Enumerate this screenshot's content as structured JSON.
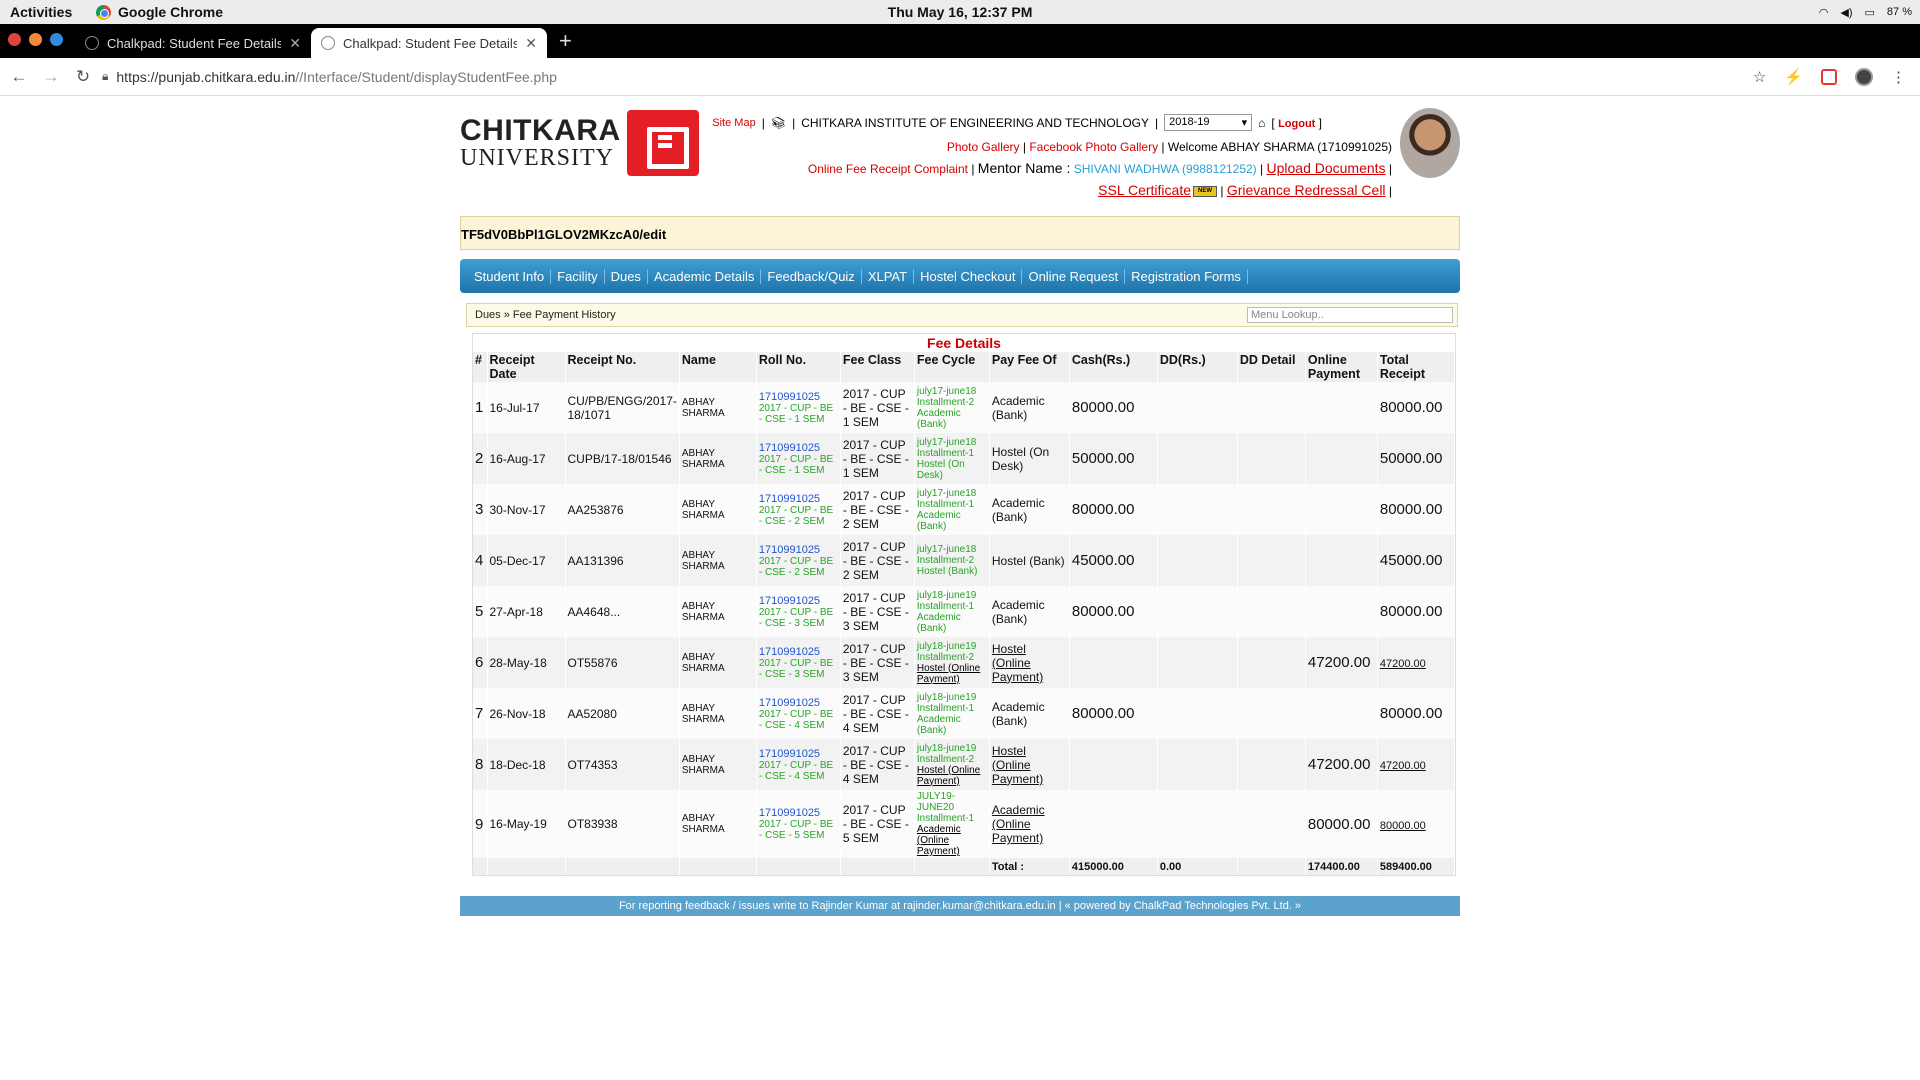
{
  "os": {
    "activities": "Activities",
    "app_name": "Google Chrome",
    "clock": "Thu May 16, 12:37 PM",
    "battery": "87 %"
  },
  "browser": {
    "tabs": [
      {
        "title": "Chalkpad: Student Fee Details"
      },
      {
        "title": "Chalkpad: Student Fee Details"
      }
    ],
    "url_host": "https://punjab.chitkara.edu.in",
    "url_path": "//Interface/Student/displayStudentFee.php"
  },
  "header": {
    "logo_line1": "CHITKARA",
    "logo_line2": "UNIVERSITY",
    "site_map": "Site Map",
    "institute": "CHITKARA INSTITUTE OF ENGINEERING AND TECHNOLOGY",
    "session": "2018-19",
    "logout": "Logout",
    "photo_gallery": "Photo Gallery",
    "facebook_gallery": "Facebook Photo Gallery",
    "welcome": "Welcome ABHAY SHARMA (1710991025)",
    "complaint": "Online Fee Receipt Complaint",
    "mentor_label": "Mentor Name :",
    "mentor_name": "SHIVANI WADHWA (9988121252)",
    "upload_docs": "Upload Documents",
    "ssl": "SSL Certificate",
    "ssl_badge": "NEW",
    "grievance": "Grievance Redressal Cell"
  },
  "notice": "TF5dV0BbPl1GLOV2MKzcA0/edit",
  "menu": [
    "Student Info",
    "Facility",
    "Dues",
    "Academic Details",
    "Feedback/Quiz",
    "XLPAT",
    "Hostel Checkout",
    "Online Request",
    "Registration Forms"
  ],
  "breadcrumb": "Dues » Fee Payment History",
  "menu_lookup_placeholder": "Menu Lookup..",
  "fee": {
    "title": "Fee Details",
    "columns": [
      "#",
      "Receipt Date",
      "Receipt No.",
      "Name",
      "Roll No.",
      "Fee Class",
      "Fee Cycle",
      "Pay Fee Of",
      "Cash(Rs.)",
      "DD(Rs.)",
      "DD Detail",
      "Online Payment",
      "Total Receipt"
    ],
    "rows": [
      {
        "n": "1",
        "date": "16-Jul-17",
        "receipt": "CU/PB/ENGG/2017-18/1071",
        "name": "ABHAY SHARMA",
        "roll": "1710991025",
        "roll_sub": "2017 - CUP - BE - CSE - 1 SEM",
        "fee_class": "2017 - CUP - BE - CSE - 1 SEM",
        "cycle": "july17-june18 Installment-2 Academic (Bank)",
        "pay_of": "Academic (Bank)",
        "cash": "80000.00",
        "dd": "",
        "dd_detail": "",
        "online": "",
        "total": "80000.00"
      },
      {
        "n": "2",
        "date": "16-Aug-17",
        "receipt": "CUPB/17-18/01546",
        "name": "ABHAY SHARMA",
        "roll": "1710991025",
        "roll_sub": "2017 - CUP - BE - CSE - 1 SEM",
        "fee_class": "2017 - CUP - BE - CSE - 1 SEM",
        "cycle": "july17-june18 Installment-1 Hostel (On Desk)",
        "pay_of": "Hostel (On Desk)",
        "cash": "50000.00",
        "dd": "",
        "dd_detail": "",
        "online": "",
        "total": "50000.00"
      },
      {
        "n": "3",
        "date": "30-Nov-17",
        "receipt": "AA253876",
        "name": "ABHAY SHARMA",
        "roll": "1710991025",
        "roll_sub": "2017 - CUP - BE - CSE - 2 SEM",
        "fee_class": "2017 - CUP - BE - CSE - 2 SEM",
        "cycle": "july17-june18 Installment-1 Academic (Bank)",
        "pay_of": "Academic (Bank)",
        "cash": "80000.00",
        "dd": "",
        "dd_detail": "",
        "online": "",
        "total": "80000.00"
      },
      {
        "n": "4",
        "date": "05-Dec-17",
        "receipt": "AA131396",
        "name": "ABHAY SHARMA",
        "roll": "1710991025",
        "roll_sub": "2017 - CUP - BE - CSE - 2 SEM",
        "fee_class": "2017 - CUP - BE - CSE - 2 SEM",
        "cycle": "july17-june18 Installment-2 Hostel (Bank)",
        "pay_of": "Hostel (Bank)",
        "cash": "45000.00",
        "dd": "",
        "dd_detail": "",
        "online": "",
        "total": "45000.00"
      },
      {
        "n": "5",
        "date": "27-Apr-18",
        "receipt": "AA4648...",
        "name": "ABHAY SHARMA",
        "roll": "1710991025",
        "roll_sub": "2017 - CUP - BE - CSE - 3 SEM",
        "fee_class": "2017 - CUP - BE - CSE - 3 SEM",
        "cycle": "july18-june19 Installment-1 Academic (Bank)",
        "pay_of": "Academic (Bank)",
        "cash": "80000.00",
        "dd": "",
        "dd_detail": "",
        "online": "",
        "total": "80000.00"
      },
      {
        "n": "6",
        "date": "28-May-18",
        "receipt": "OT55876",
        "name": "ABHAY SHARMA",
        "roll": "1710991025",
        "roll_sub": "2017 - CUP - BE - CSE - 3 SEM",
        "fee_class": "2017 - CUP - BE - CSE - 3 SEM",
        "cycle": "july18-june19 Installment-2",
        "cycle_link": "Hostel (Online Payment)",
        "pay_of": "Hostel (Online Payment)",
        "pay_link": true,
        "cash": "",
        "dd": "",
        "dd_detail": "",
        "online": "47200.00",
        "total": "47200.00",
        "total_link": true
      },
      {
        "n": "7",
        "date": "26-Nov-18",
        "receipt": "AA52080",
        "name": "ABHAY SHARMA",
        "roll": "1710991025",
        "roll_sub": "2017 - CUP - BE - CSE - 4 SEM",
        "fee_class": "2017 - CUP - BE - CSE - 4 SEM",
        "cycle": "july18-june19 Installment-1 Academic (Bank)",
        "pay_of": "Academic (Bank)",
        "cash": "80000.00",
        "dd": "",
        "dd_detail": "",
        "online": "",
        "total": "80000.00"
      },
      {
        "n": "8",
        "date": "18-Dec-18",
        "receipt": "OT74353",
        "name": "ABHAY SHARMA",
        "roll": "1710991025",
        "roll_sub": "2017 - CUP - BE - CSE - 4 SEM",
        "fee_class": "2017 - CUP - BE - CSE - 4 SEM",
        "cycle": "july18-june19 Installment-2",
        "cycle_link": "Hostel (Online Payment)",
        "pay_of": "Hostel (Online Payment)",
        "pay_link": true,
        "cash": "",
        "dd": "",
        "dd_detail": "",
        "online": "47200.00",
        "total": "47200.00",
        "total_link": true
      },
      {
        "n": "9",
        "date": "16-May-19",
        "receipt": "OT83938",
        "name": "ABHAY SHARMA",
        "roll": "1710991025",
        "roll_sub": "2017 - CUP - BE - CSE - 5 SEM",
        "fee_class": "2017 - CUP - BE - CSE - 5 SEM",
        "cycle": "JULY19-JUNE20 Installment-1",
        "cycle_link": "Academic (Online Payment)",
        "pay_of": "Academic (Online Payment)",
        "pay_link": true,
        "cash": "",
        "dd": "",
        "dd_detail": "",
        "online": "80000.00",
        "total": "80000.00",
        "total_link": true
      }
    ],
    "total_label": "Total :",
    "total_cash": "415000.00",
    "total_dd": "0.00",
    "total_online": "174400.00",
    "total_receipt": "589400.00"
  },
  "footer": "For reporting feedback / issues write to Rajinder Kumar at rajinder.kumar@chitkara.edu.in | « powered by ChalkPad Technologies Pvt. Ltd. »"
}
